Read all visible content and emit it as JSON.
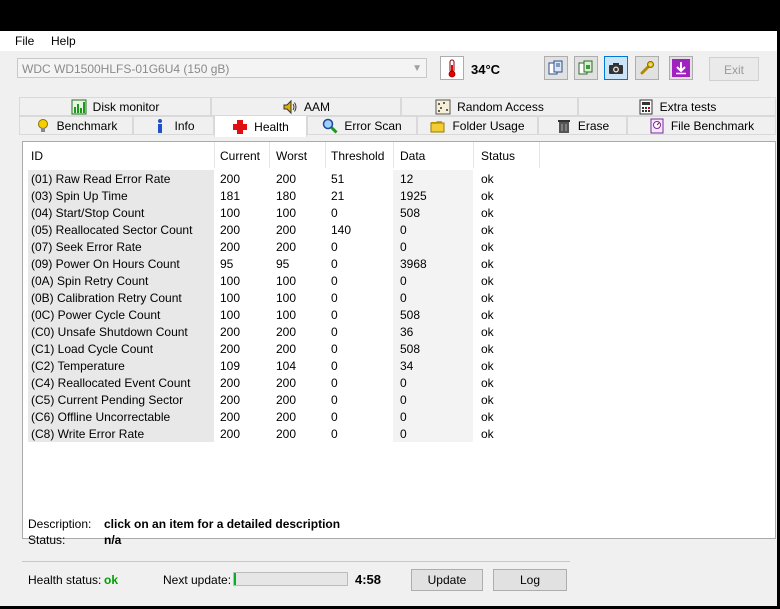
{
  "menu": {
    "file": "File",
    "help": "Help"
  },
  "toolbar": {
    "drive": "WDC WD1500HLFS-01G6U4 (150 gB)",
    "temperature": "34°C",
    "exit_label": "Exit"
  },
  "tabs_top": [
    {
      "label": "Disk monitor"
    },
    {
      "label": "AAM"
    },
    {
      "label": "Random Access"
    },
    {
      "label": "Extra tests"
    }
  ],
  "tabs_bottom": [
    {
      "label": "Benchmark"
    },
    {
      "label": "Info"
    },
    {
      "label": "Health"
    },
    {
      "label": "Error Scan"
    },
    {
      "label": "Folder Usage"
    },
    {
      "label": "Erase"
    },
    {
      "label": "File Benchmark"
    }
  ],
  "table": {
    "headers": [
      "ID",
      "Current",
      "Worst",
      "Threshold",
      "Data",
      "Status"
    ],
    "rows": [
      [
        "(01) Raw Read Error Rate",
        "200",
        "200",
        "51",
        "12",
        "ok"
      ],
      [
        "(03) Spin Up Time",
        "181",
        "180",
        "21",
        "1925",
        "ok"
      ],
      [
        "(04) Start/Stop Count",
        "100",
        "100",
        "0",
        "508",
        "ok"
      ],
      [
        "(05) Reallocated Sector Count",
        "200",
        "200",
        "140",
        "0",
        "ok"
      ],
      [
        "(07) Seek Error Rate",
        "200",
        "200",
        "0",
        "0",
        "ok"
      ],
      [
        "(09) Power On Hours Count",
        "95",
        "95",
        "0",
        "3968",
        "ok"
      ],
      [
        "(0A) Spin Retry Count",
        "100",
        "100",
        "0",
        "0",
        "ok"
      ],
      [
        "(0B) Calibration Retry Count",
        "100",
        "100",
        "0",
        "0",
        "ok"
      ],
      [
        "(0C) Power Cycle Count",
        "100",
        "100",
        "0",
        "508",
        "ok"
      ],
      [
        "(C0) Unsafe Shutdown Count",
        "200",
        "200",
        "0",
        "36",
        "ok"
      ],
      [
        "(C1) Load Cycle Count",
        "200",
        "200",
        "0",
        "508",
        "ok"
      ],
      [
        "(C2) Temperature",
        "109",
        "104",
        "0",
        "34",
        "ok"
      ],
      [
        "(C4) Reallocated Event Count",
        "200",
        "200",
        "0",
        "0",
        "ok"
      ],
      [
        "(C5) Current Pending Sector",
        "200",
        "200",
        "0",
        "0",
        "ok"
      ],
      [
        "(C6) Offline Uncorrectable",
        "200",
        "200",
        "0",
        "0",
        "ok"
      ],
      [
        "(C8) Write Error Rate",
        "200",
        "200",
        "0",
        "0",
        "ok"
      ]
    ]
  },
  "footer": {
    "description_label": "Description:",
    "description_value": "click on an item for a detailed description",
    "status_label": "Status:",
    "status_value": "n/a",
    "health_label": "Health status:",
    "health_value": "ok",
    "health_color": "#00a000",
    "next_update_label": "Next update:",
    "next_update_time": "4:58",
    "progress_fraction": 0.02,
    "update_button": "Update",
    "log_button": "Log"
  }
}
